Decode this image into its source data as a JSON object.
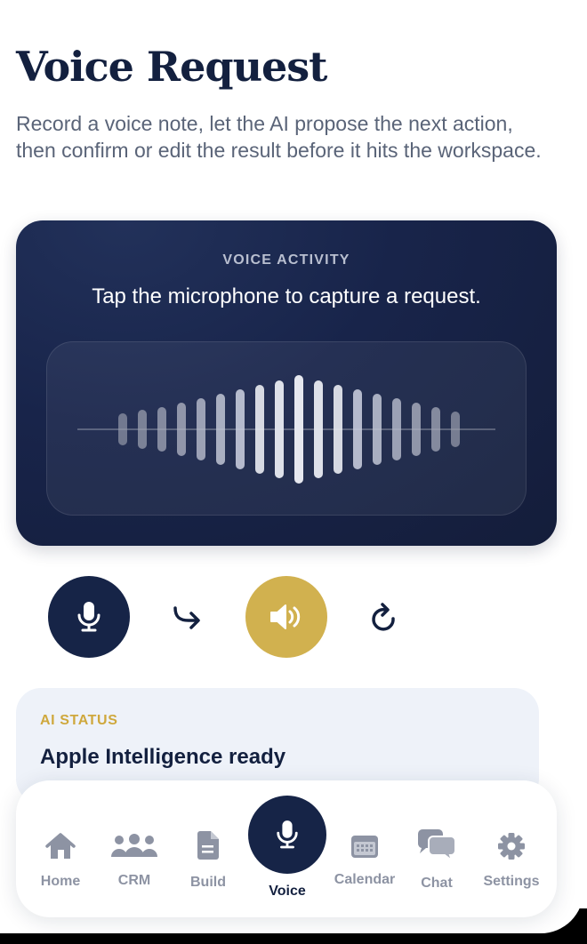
{
  "page": {
    "title": "Voice Request",
    "subtitle": "Record a voice note, let the AI propose the next action, then confirm or edit the result before it hits the workspace."
  },
  "voice_card": {
    "eyebrow": "VOICE ACTIVITY",
    "prompt": "Tap the microphone to capture a request.",
    "waveform_levels": [
      0.18,
      0.22,
      0.26,
      0.31,
      0.36,
      0.41,
      0.46,
      0.51,
      0.56,
      0.62,
      0.56,
      0.51,
      0.46,
      0.41,
      0.36,
      0.31,
      0.26,
      0.2
    ],
    "colors": {
      "card": "#18244a",
      "bar": "#8b91a7",
      "bar_active": "#e6e8ef"
    }
  },
  "controls": {
    "mic_icon": "microphone-icon",
    "forward_icon": "arrow-forward-icon",
    "speaker_icon": "speaker-icon",
    "refresh_icon": "refresh-icon",
    "colors": {
      "mic": "#162447",
      "speaker": "#d1b14f"
    }
  },
  "status": {
    "eyebrow": "AI STATUS",
    "text": "Apple Intelligence ready",
    "colors": {
      "eyebrow": "#cfa83d"
    }
  },
  "tabbar": {
    "tabs": [
      {
        "label": "Home",
        "icon": "home-icon"
      },
      {
        "label": "CRM",
        "icon": "people-icon"
      },
      {
        "label": "Build",
        "icon": "document-icon"
      },
      {
        "label": "Voice",
        "icon": "microphone-icon",
        "selected": true
      },
      {
        "label": "Calendar",
        "icon": "calendar-icon"
      },
      {
        "label": "Chat",
        "icon": "chat-bubbles-icon"
      },
      {
        "label": "Settings",
        "icon": "gear-icon"
      }
    ]
  }
}
